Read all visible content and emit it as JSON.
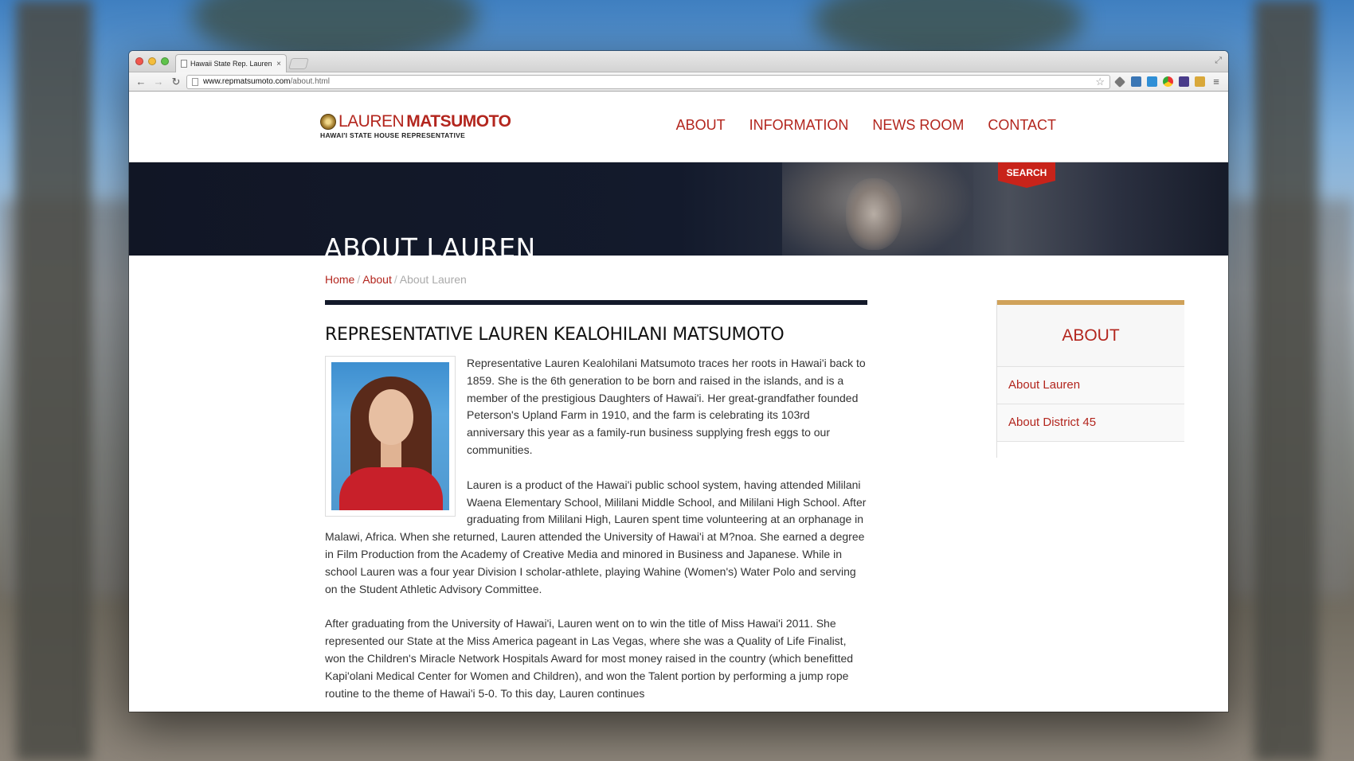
{
  "browser": {
    "tab_title": "Hawaii State Rep. Lauren M",
    "tab_close": "×",
    "url_host": "www.repmatsumoto.com",
    "url_path": "/about.html",
    "nav_back": "←",
    "nav_forward": "→",
    "nav_reload": "↻",
    "star": "☆",
    "fullscreen": "⤢",
    "menu": "≡",
    "wrench": "🔧"
  },
  "site": {
    "logo_first": "LAUREN",
    "logo_last": "MATSUMOTO",
    "logo_sub": "HAWAI'I STATE HOUSE REPRESENTATIVE",
    "nav": [
      "ABOUT",
      "INFORMATION",
      "NEWS ROOM",
      "CONTACT"
    ],
    "search_label": "SEARCH",
    "hero_title": "ABOUT LAUREN",
    "accent_red": "#b3261e",
    "accent_gold": "#d0a25a",
    "hero_navy": "#141a2a"
  },
  "breadcrumb": {
    "home": "Home",
    "about": "About",
    "current": "About Lauren",
    "sep": "/"
  },
  "content": {
    "heading": "REPRESENTATIVE LAUREN KEALOHILANI MATSUMOTO",
    "paragraphs": [
      "Representative Lauren Kealohilani Matsumoto traces her roots in Hawai'i back to 1859. She is the 6th generation to be born and raised in the islands, and is a member of the prestigious Daughters of Hawai'i. Her great-grandfather founded Peterson's Upland Farm in 1910, and the farm is celebrating its 103rd anniversary this year as a family-run business supplying fresh eggs to our communities.",
      "Lauren is a product of the Hawai'i public school system, having attended Mililani Waena Elementary School, Mililani Middle School, and Mililani High School. After graduating from Mililani High, Lauren spent time volunteering at an orphanage in Malawi, Africa. When she returned, Lauren attended the University of Hawai'i at M?noa. She earned a degree in Film Production from the Academy of Creative Media and minored in Business and Japanese. While in school Lauren was a four year Division I scholar-athlete, playing Wahine (Women's) Water Polo and serving on the Student Athletic Advisory Committee.",
      "After graduating from the University of Hawai'i, Lauren went on to win the title of Miss Hawai'i 2011. She represented our State at the Miss America pageant in Las Vegas, where she was a Quality of Life Finalist, won the Children's Miracle Network Hospitals Award for most money raised in the country (which benefitted Kapi'olani Medical Center for Women and Children), and won the Talent portion by performing a jump rope routine to the theme of Hawai'i 5-0. To this day, Lauren continues"
    ]
  },
  "sidebar": {
    "title": "ABOUT",
    "items": [
      "About Lauren",
      "About District 45"
    ]
  }
}
